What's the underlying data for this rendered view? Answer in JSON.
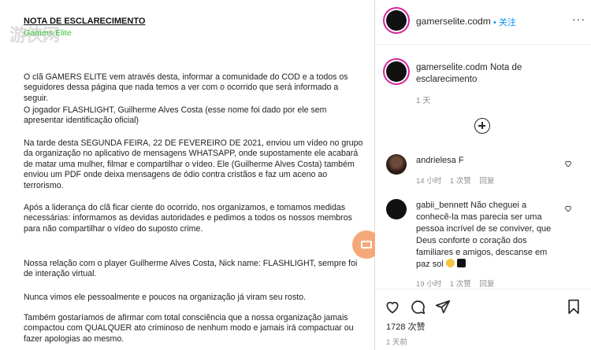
{
  "colors": {
    "accent": "#0095f6",
    "secondary_text": "#8e8e8e",
    "doc_subtitle": "#3bbf3b"
  },
  "document": {
    "title": "NOTA DE ESCLARECIMENTO",
    "subtitle": "Gamers Elite",
    "watermark": "游侠网",
    "paragraphs": [
      "O clã GAMERS ELITE vem através desta, informar a comunidade do COD e a todos os seguidores dessa página que nada temos a ver com o ocorrido que será informado a seguir.",
      "O jogador FLASHLIGHT, Guilherme Alves Costa (esse nome foi dado por ele sem apresentar identificação oficial)",
      "Na tarde desta SEGUNDA FEIRA, 22 DE FEVEREIRO DE 2021, enviou um vídeo no grupo da organização no aplicativo de mensagens WHATSAPP, onde supostamente ele acabará de matar uma mulher, filmar e compartilhar o vídeo. Ele (Guilherme Alves Costa) também enviou um PDF onde deixa mensagens de ódio contra cristãos e faz um aceno ao terrorismo.",
      "Após a liderança do clã ficar ciente do ocorrido, nos organizamos, e tomamos medidas necessárias: informamos as devidas autoridades e pedimos a todos os nossos membros para não compartilhar o vídeo do suposto crime.",
      "Nossa relação com o player Guilherme Alves Costa, Nick name: FLASHLIGHT, sempre foi de interação virtual.",
      "Nunca vimos ele pessoalmente e poucos na organização já viram seu rosto.",
      "Também gostaríamos de afirmar com total consciência que a nossa organização jamais compactou com QUALQUER ato criminoso de nenhum modo e jamais irá compactuar ou fazer apologias ao mesmo."
    ]
  },
  "header": {
    "username": "gamerselite.codm",
    "separator": "•",
    "follow_label": "关注",
    "more_icon": "more-icon",
    "more_label": "···"
  },
  "caption": {
    "username": "gamerselite.codm",
    "text": "Nota de esclarecimento",
    "time": "1 天"
  },
  "load_more_icon": "plus-circle-icon",
  "comments": [
    {
      "username": "andrielesa",
      "text": "F",
      "time": "14 小时",
      "likes": "1 次赞",
      "reply": "回复"
    },
    {
      "username": "gabii_bennett",
      "text": "Não cheguei a conhecê-la mas parecia ser uma pessoa incrível de se conviver, que Deus conforte o coração dos familiares e amigos, descanse em paz sol",
      "time": "19 小时",
      "likes": "1 次赞",
      "reply": "回复"
    }
  ],
  "actions": {
    "icons": [
      "heart-icon",
      "comment-icon",
      "share-icon",
      "bookmark-icon"
    ]
  },
  "likes_label": "1728 次赞",
  "date_label": "1 天前"
}
